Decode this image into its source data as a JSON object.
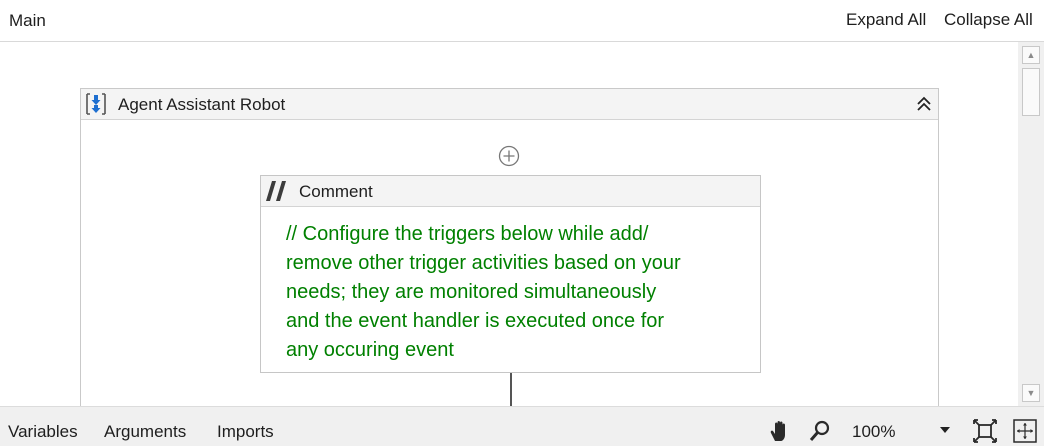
{
  "header": {
    "title": "Main",
    "expand_all": "Expand All",
    "collapse_all": "Collapse All"
  },
  "sequence": {
    "title": "Agent Assistant Robot",
    "icon": "sequence-icon",
    "collapse_icon": "double-chevron-up-icon"
  },
  "add_activity_icon": "plus-circle-icon",
  "comment": {
    "title": "Comment",
    "icon": "comment-icon",
    "lines": [
      "// Configure the triggers below while add/",
      "remove other trigger activities based on your",
      "needs; they are monitored simultaneously",
      "and the event handler is executed once for",
      "any occuring event"
    ],
    "text_color": "#008000"
  },
  "footer": {
    "tabs": [
      "Variables",
      "Arguments",
      "Imports"
    ],
    "zoom": "100%",
    "icons": [
      "hand-pan-icon",
      "zoom-search-icon",
      "fit-to-screen-icon",
      "overview-icon"
    ]
  }
}
